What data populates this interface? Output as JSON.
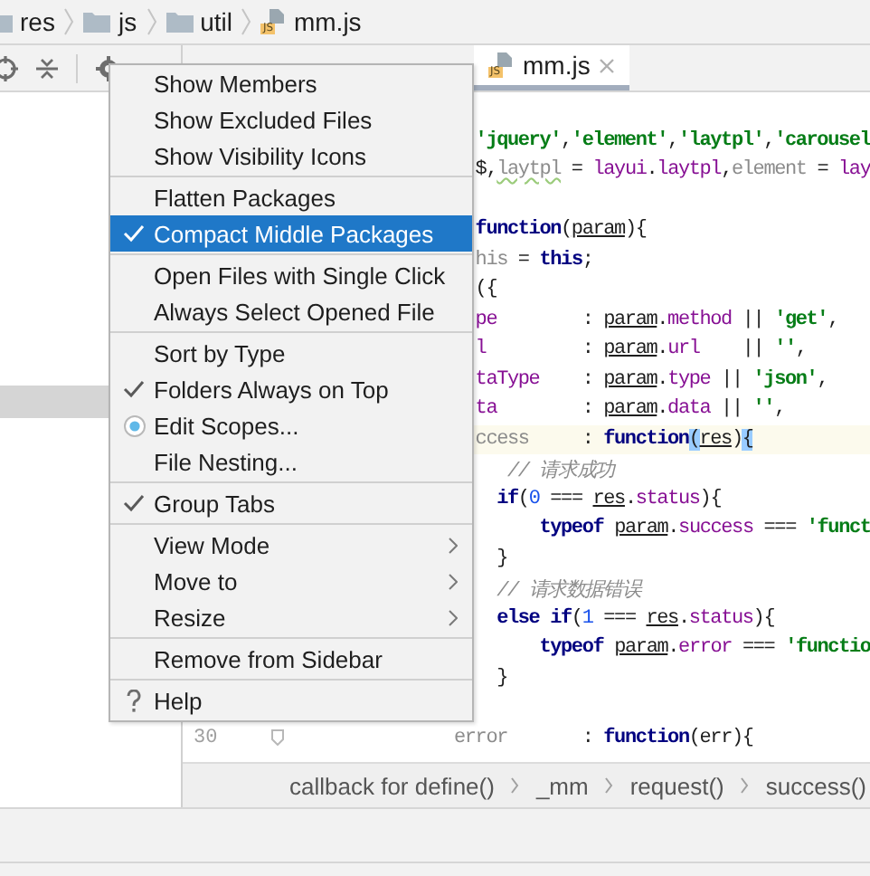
{
  "breadcrumbs": [
    {
      "label": "res",
      "kind": "folder"
    },
    {
      "label": "js",
      "kind": "folder"
    },
    {
      "label": "util",
      "kind": "folder"
    },
    {
      "label": "mm.js",
      "kind": "js",
      "badge": "JS"
    }
  ],
  "editor_tabs": [
    {
      "kind": "js",
      "label": "mm.js",
      "badge": "JS",
      "selected": true
    }
  ],
  "code_lines": [
    {
      "kind": "blank"
    },
    {
      "kind": "code",
      "segments": [
        {
          "kind": "str",
          "text": "  'jquery'"
        },
        {
          "kind": "plain",
          "text": ","
        },
        {
          "kind": "str",
          "text": "'element'"
        },
        {
          "kind": "plain",
          "text": ","
        },
        {
          "kind": "str",
          "text": "'laytpl'"
        },
        {
          "kind": "plain",
          "text": ","
        },
        {
          "kind": "str",
          "text": "'carousel"
        }
      ]
    },
    {
      "kind": "code",
      "segments": [
        {
          "kind": "plain",
          "text": "  $,"
        },
        {
          "kind": "unused",
          "text": "laytpl"
        },
        {
          "kind": "plain",
          "text": " = "
        },
        {
          "kind": "prop",
          "text": "layui"
        },
        {
          "kind": "plain",
          "text": "."
        },
        {
          "kind": "prop",
          "text": "laytpl"
        },
        {
          "kind": "plain",
          "text": ","
        },
        {
          "kind": "dim",
          "text": "element"
        },
        {
          "kind": "plain",
          "text": " = "
        },
        {
          "kind": "prop",
          "text": "lay"
        }
      ]
    },
    {
      "kind": "blank"
    },
    {
      "kind": "code",
      "segments": [
        {
          "kind": "kw",
          "text": "  function"
        },
        {
          "kind": "plain",
          "text": "("
        },
        {
          "kind": "param",
          "text": "param"
        },
        {
          "kind": "plain",
          "text": "){"
        }
      ]
    },
    {
      "kind": "code",
      "segments": [
        {
          "kind": "dim",
          "text": "  his"
        },
        {
          "kind": "plain",
          "text": " = "
        },
        {
          "kind": "kw",
          "text": "this"
        },
        {
          "kind": "plain",
          "text": ";"
        }
      ]
    },
    {
      "kind": "code",
      "segments": [
        {
          "kind": "plain",
          "text": "  ({"
        }
      ]
    },
    {
      "kind": "code",
      "segments": [
        {
          "kind": "prop",
          "text": "  pe"
        },
        {
          "kind": "plain",
          "text": "        : "
        },
        {
          "kind": "param",
          "text": "param"
        },
        {
          "kind": "plain",
          "text": "."
        },
        {
          "kind": "prop",
          "text": "method"
        },
        {
          "kind": "plain",
          "text": " || "
        },
        {
          "kind": "str",
          "text": "'get'"
        },
        {
          "kind": "plain",
          "text": ","
        }
      ]
    },
    {
      "kind": "code",
      "segments": [
        {
          "kind": "prop",
          "text": "  l"
        },
        {
          "kind": "plain",
          "text": "         : "
        },
        {
          "kind": "param",
          "text": "param"
        },
        {
          "kind": "plain",
          "text": "."
        },
        {
          "kind": "prop",
          "text": "url"
        },
        {
          "kind": "plain",
          "text": "    || "
        },
        {
          "kind": "str",
          "text": "''"
        },
        {
          "kind": "plain",
          "text": ","
        }
      ]
    },
    {
      "kind": "code",
      "segments": [
        {
          "kind": "prop",
          "text": "  taType"
        },
        {
          "kind": "plain",
          "text": "    : "
        },
        {
          "kind": "param",
          "text": "param"
        },
        {
          "kind": "plain",
          "text": "."
        },
        {
          "kind": "prop",
          "text": "type"
        },
        {
          "kind": "plain",
          "text": " || "
        },
        {
          "kind": "str",
          "text": "'json'"
        },
        {
          "kind": "plain",
          "text": ","
        }
      ]
    },
    {
      "kind": "code",
      "segments": [
        {
          "kind": "prop",
          "text": "  ta"
        },
        {
          "kind": "plain",
          "text": "        : "
        },
        {
          "kind": "param",
          "text": "param"
        },
        {
          "kind": "plain",
          "text": "."
        },
        {
          "kind": "prop",
          "text": "data"
        },
        {
          "kind": "plain",
          "text": " || "
        },
        {
          "kind": "str",
          "text": "''"
        },
        {
          "kind": "plain",
          "text": ","
        }
      ]
    },
    {
      "kind": "code",
      "current": true,
      "segments": [
        {
          "kind": "dim",
          "text": "  ccess"
        },
        {
          "kind": "plain",
          "text": "     : "
        },
        {
          "kind": "kw",
          "text": "function"
        },
        {
          "kind": "match",
          "text": "("
        },
        {
          "kind": "param",
          "text": "res"
        },
        {
          "kind": "plain",
          "text": ")"
        },
        {
          "kind": "match",
          "text": "{"
        }
      ]
    },
    {
      "kind": "code",
      "segments": [
        {
          "kind": "comment",
          "text": "     // 请求成功"
        }
      ]
    },
    {
      "kind": "code",
      "segments": [
        {
          "kind": "kw",
          "text": "    if"
        },
        {
          "kind": "plain",
          "text": "("
        },
        {
          "kind": "num",
          "text": "0"
        },
        {
          "kind": "plain",
          "text": " === "
        },
        {
          "kind": "param",
          "text": "res"
        },
        {
          "kind": "plain",
          "text": "."
        },
        {
          "kind": "prop",
          "text": "status"
        },
        {
          "kind": "plain",
          "text": "){"
        }
      ]
    },
    {
      "kind": "code",
      "segments": [
        {
          "kind": "kw",
          "text": "        typeof"
        },
        {
          "kind": "gap",
          "text": "param"
        },
        {
          "kind": "plain",
          "text": "."
        },
        {
          "kind": "prop",
          "text": "success"
        },
        {
          "kind": "plain",
          "text": " === "
        },
        {
          "kind": "str",
          "text": "'funct"
        }
      ]
    },
    {
      "kind": "code",
      "segments": [
        {
          "kind": "plain",
          "text": "    }"
        }
      ]
    },
    {
      "kind": "code",
      "segments": [
        {
          "kind": "comment",
          "text": "    // 请求数据错误"
        }
      ]
    },
    {
      "kind": "code",
      "segments": [
        {
          "kind": "kw",
          "text": "    else if"
        },
        {
          "kind": "plain",
          "text": "("
        },
        {
          "kind": "num",
          "text": "1"
        },
        {
          "kind": "plain",
          "text": " === "
        },
        {
          "kind": "param",
          "text": "res"
        },
        {
          "kind": "plain",
          "text": "."
        },
        {
          "kind": "prop",
          "text": "status"
        },
        {
          "kind": "plain",
          "text": "){"
        }
      ]
    },
    {
      "kind": "code",
      "segments": [
        {
          "kind": "kw",
          "text": "        typeof"
        },
        {
          "kind": "gap",
          "text": "param"
        },
        {
          "kind": "plain",
          "text": "."
        },
        {
          "kind": "prop",
          "text": "error"
        },
        {
          "kind": "plain",
          "text": " === "
        },
        {
          "kind": "str",
          "text": "'functio"
        }
      ]
    },
    {
      "kind": "code",
      "segments": [
        {
          "kind": "plain",
          "text": "    }"
        }
      ]
    },
    {
      "kind": "blank"
    },
    {
      "kind": "code",
      "number": "30",
      "segments": [
        {
          "kind": "dim",
          "text": "error"
        },
        {
          "kind": "plain",
          "text": "       : "
        },
        {
          "kind": "kw",
          "text": "function"
        },
        {
          "kind": "plain",
          "text": "(err){"
        }
      ]
    }
  ],
  "code_breadcrumbs": [
    "callback for define()",
    "_mm",
    "request()",
    "success()"
  ],
  "menu": {
    "groups": [
      [
        {
          "label": "Show Members",
          "kind": "toggle",
          "checked": false,
          "selected": false
        },
        {
          "label": "Show Excluded Files",
          "kind": "toggle",
          "checked": false,
          "selected": false
        },
        {
          "label": "Show Visibility Icons",
          "kind": "toggle",
          "checked": false,
          "selected": false
        }
      ],
      [
        {
          "label": "Flatten Packages",
          "kind": "toggle",
          "checked": false,
          "selected": false
        },
        {
          "label": "Compact Middle Packages",
          "kind": "toggle",
          "checked": true,
          "selected": true
        }
      ],
      [
        {
          "label": "Open Files with Single Click",
          "kind": "toggle",
          "checked": false,
          "selected": false
        },
        {
          "label": "Always Select Opened File",
          "kind": "toggle",
          "checked": false,
          "selected": false
        }
      ],
      [
        {
          "label": "Sort by Type",
          "kind": "toggle",
          "checked": false,
          "selected": false
        },
        {
          "label": "Folders Always on Top",
          "kind": "toggle",
          "checked": true,
          "selected": false
        },
        {
          "label": "Edit Scopes...",
          "kind": "radio",
          "checked": true,
          "selected": false
        },
        {
          "label": "File Nesting...",
          "kind": "action",
          "selected": false
        }
      ],
      [
        {
          "label": "Group Tabs",
          "kind": "toggle",
          "checked": true,
          "selected": false
        }
      ],
      [
        {
          "label": "View Mode",
          "kind": "submenu",
          "selected": false
        },
        {
          "label": "Move to",
          "kind": "submenu",
          "selected": false
        },
        {
          "label": "Resize",
          "kind": "submenu",
          "selected": false
        }
      ],
      [
        {
          "label": "Remove from Sidebar",
          "kind": "action",
          "selected": false
        }
      ],
      [
        {
          "label": "Help",
          "kind": "help",
          "selected": false
        }
      ]
    ]
  }
}
